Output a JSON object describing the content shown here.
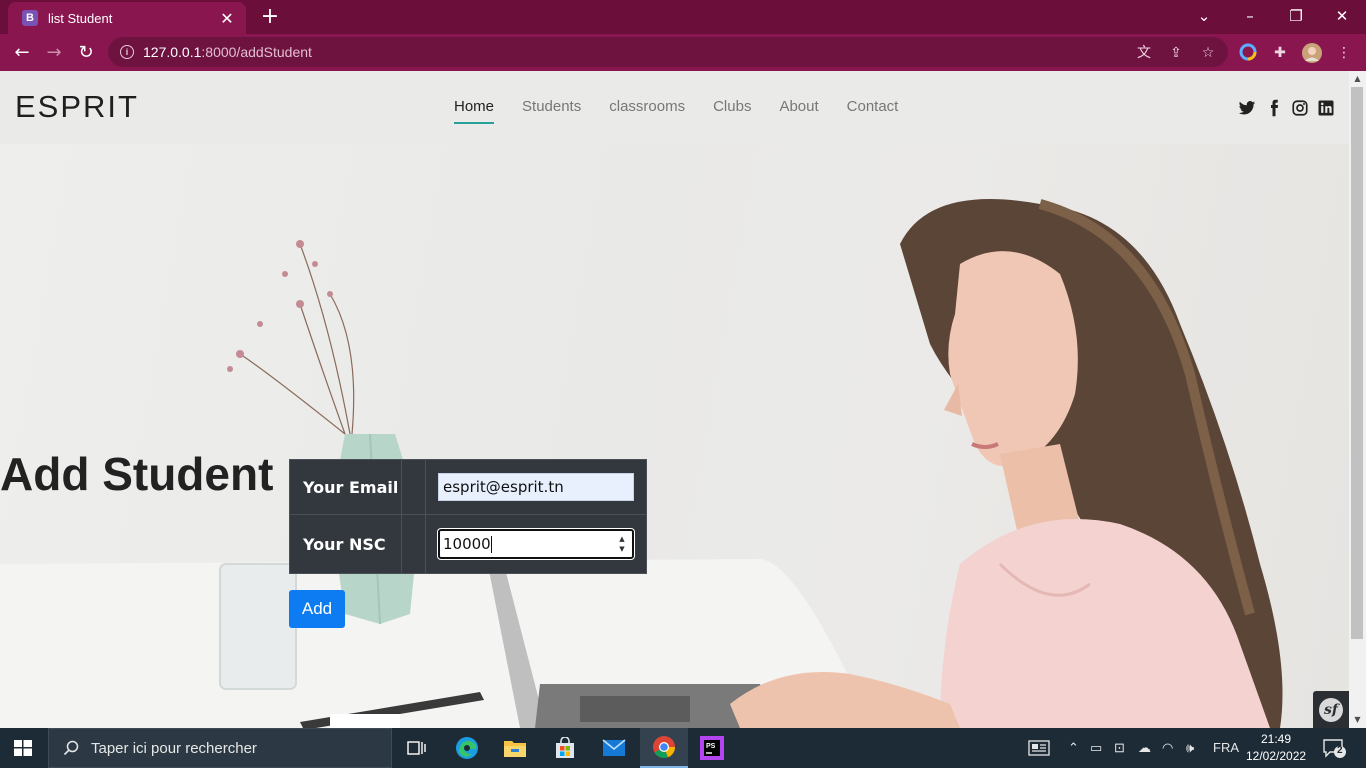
{
  "browser": {
    "tab_icon_letter": "B",
    "tab_title": "list Student",
    "url_host": "127.0.0.1",
    "url_rest": ":8000/addStudent"
  },
  "site": {
    "logo": "ESPRIT",
    "nav": [
      "Home",
      "Students",
      "classrooms",
      "Clubs",
      "About",
      "Contact"
    ],
    "active_nav": "Home",
    "social_icons": [
      "twitter-icon",
      "facebook-icon",
      "instagram-icon",
      "linkedin-icon"
    ]
  },
  "form": {
    "heading": "Add Student",
    "email_label": "Your Email",
    "email_value": "esprit@esprit.tn",
    "nsc_label": "Your NSC",
    "nsc_value": "10000",
    "submit_label": "Add"
  },
  "taskbar": {
    "search_placeholder": "Taper ici pour rechercher",
    "language": "FRA",
    "time": "21:49",
    "date": "12/02/2022",
    "notification_count": "2"
  },
  "colors": {
    "browser_frame": "#6b0f3a",
    "toolbar": "#8a1650",
    "nav_active_underline": "#2aa198",
    "form_bg": "#33383e",
    "button": "#0d7cf2",
    "taskbar": "#1d2b36"
  }
}
